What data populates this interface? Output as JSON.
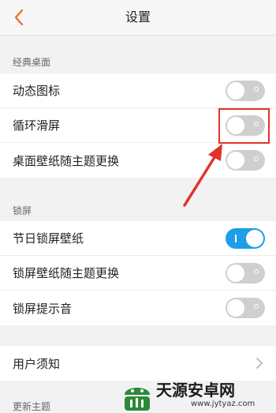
{
  "header": {
    "title": "设置",
    "back_icon": "chevron-left-icon",
    "accent": "#ee6a1e"
  },
  "sections": [
    {
      "label": "经典桌面",
      "rows": [
        {
          "label": "动态图标",
          "toggle": "off"
        },
        {
          "label": "循环滑屏",
          "toggle": "off"
        },
        {
          "label": "桌面壁纸随主题更换",
          "toggle": "off"
        }
      ]
    },
    {
      "label": "锁屏",
      "rows": [
        {
          "label": "节日锁屏壁纸",
          "toggle": "on"
        },
        {
          "label": "锁屏壁纸随主题更换",
          "toggle": "off"
        },
        {
          "label": "锁屏提示音",
          "toggle": "off"
        }
      ]
    },
    {
      "rows": [
        {
          "label": "用户须知",
          "chevron": true
        }
      ]
    },
    {
      "label": "更新主题"
    }
  ],
  "colors": {
    "toggle_on": "#1e9ee8",
    "toggle_off": "#cfcfcf",
    "annotation": "#e0332c"
  },
  "watermark": {
    "text": "天源安卓网",
    "url": "www.jytyaz.com"
  }
}
